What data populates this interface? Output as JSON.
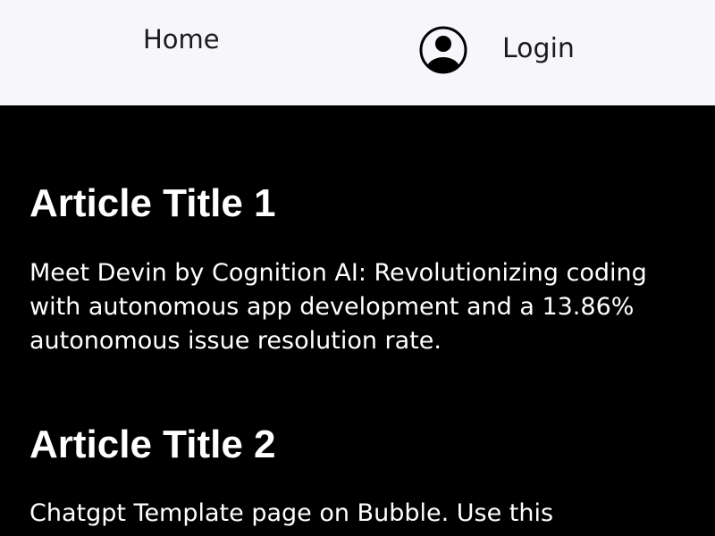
{
  "nav": {
    "home_label": "Home",
    "login_label": "Login",
    "user_icon": "user-circle-icon"
  },
  "articles": [
    {
      "title": "Article Title 1",
      "body": "Meet Devin by Cognition AI: Revolutionizing coding with autonomous app development and a 13.86% autonomous issue resolution rate."
    },
    {
      "title": "Article Title 2",
      "body": "Chatgpt Template page on Bubble. Use this"
    }
  ],
  "colors": {
    "header_bg": "#f7f6fb",
    "content_bg": "#000000",
    "text_dark": "#1b1b1f",
    "text_light": "#ffffff"
  }
}
